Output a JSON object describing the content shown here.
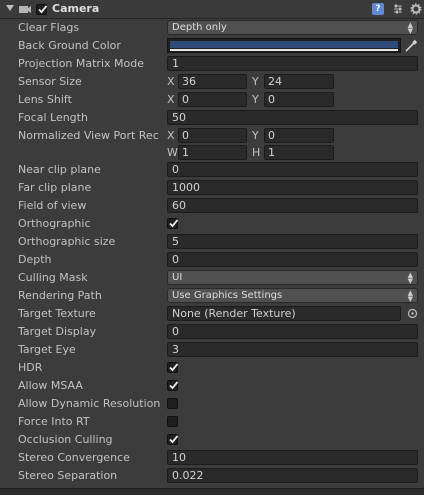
{
  "component": {
    "title": "Camera",
    "enabled": true,
    "help_glyph": "?"
  },
  "fields": {
    "clear_flags": {
      "label": "Clear Flags",
      "value": "Depth only"
    },
    "background_color": {
      "label": "Back Ground Color",
      "value": "#2f4b7a"
    },
    "projection_matrix_mode": {
      "label": "Projection Matrix Mode",
      "value": "1"
    },
    "sensor_size": {
      "label": "Sensor Size",
      "x_label": "X",
      "x": "36",
      "y_label": "Y",
      "y": "24"
    },
    "lens_shift": {
      "label": "Lens Shift",
      "x_label": "X",
      "x": "0",
      "y_label": "Y",
      "y": "0"
    },
    "focal_length": {
      "label": "Focal Length",
      "value": "50"
    },
    "viewport_rect": {
      "label": "Normalized View Port Rec",
      "x_label": "X",
      "x": "0",
      "y_label": "Y",
      "y": "0",
      "w_label": "W",
      "w": "1",
      "h_label": "H",
      "h": "1"
    },
    "near_clip": {
      "label": "Near clip plane",
      "value": "0"
    },
    "far_clip": {
      "label": "Far clip plane",
      "value": "1000"
    },
    "fov": {
      "label": "Field of view",
      "value": "60"
    },
    "orthographic": {
      "label": "Orthographic",
      "checked": true
    },
    "ortho_size": {
      "label": "Orthographic size",
      "value": "5"
    },
    "depth": {
      "label": "Depth",
      "value": "0"
    },
    "culling_mask": {
      "label": "Culling Mask",
      "value": "UI"
    },
    "rendering_path": {
      "label": "Rendering Path",
      "value": "Use Graphics Settings"
    },
    "target_texture": {
      "label": "Target Texture",
      "value": "None (Render Texture)"
    },
    "target_display": {
      "label": "Target Display",
      "value": "0"
    },
    "target_eye": {
      "label": "Target Eye",
      "value": "3"
    },
    "hdr": {
      "label": "HDR",
      "checked": true
    },
    "allow_msaa": {
      "label": "Allow MSAA",
      "checked": true
    },
    "allow_dynamic_resolution": {
      "label": "Allow Dynamic Resolution",
      "checked": false
    },
    "force_into_rt": {
      "label": "Force Into RT",
      "checked": false
    },
    "occlusion_culling": {
      "label": "Occlusion Culling",
      "checked": true
    },
    "stereo_convergence": {
      "label": "Stereo Convergence",
      "value": "10"
    },
    "stereo_separation": {
      "label": "Stereo Separation",
      "value": "0.022"
    }
  }
}
